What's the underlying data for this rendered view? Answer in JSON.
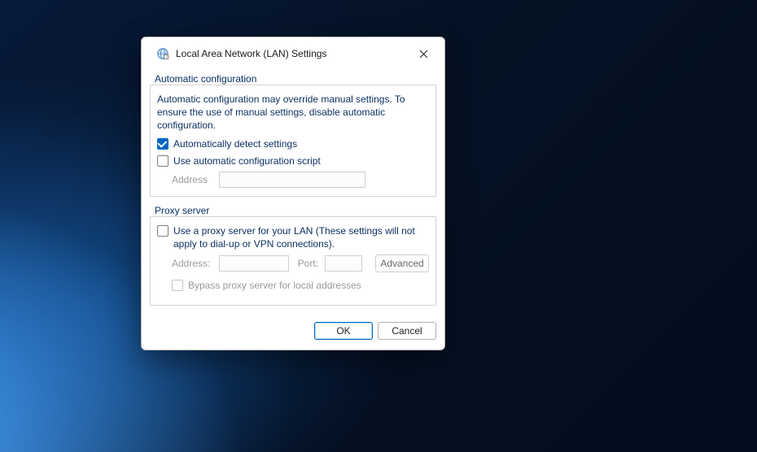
{
  "dialog": {
    "title": "Local Area Network (LAN) Settings",
    "auto": {
      "group_label": "Automatic configuration",
      "description": "Automatic configuration may override manual settings.  To ensure the use of manual settings, disable automatic configuration.",
      "detect_label": "Automatically detect settings",
      "detect_checked": true,
      "script_label": "Use automatic configuration script",
      "script_checked": false,
      "address_label": "Address",
      "address_value": ""
    },
    "proxy": {
      "group_label": "Proxy server",
      "use_label": "Use a proxy server for your LAN (These settings will not apply to dial-up or VPN connections).",
      "use_checked": false,
      "address_label": "Address:",
      "address_value": "",
      "port_label": "Port:",
      "port_value": "",
      "advanced_label": "Advanced",
      "bypass_label": "Bypass proxy server for local addresses",
      "bypass_checked": false
    },
    "buttons": {
      "ok": "OK",
      "cancel": "Cancel"
    }
  }
}
